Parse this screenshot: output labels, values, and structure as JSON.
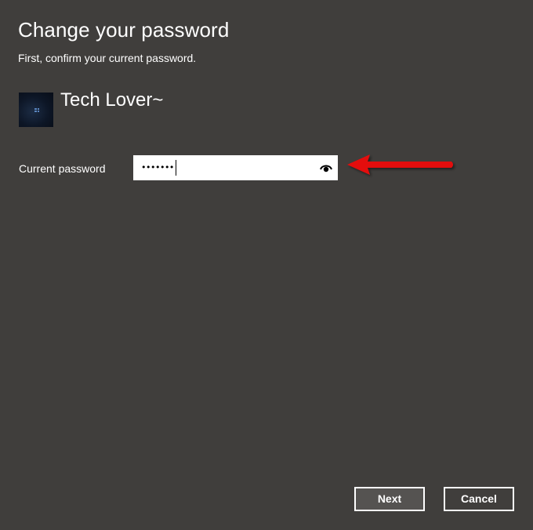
{
  "dialog": {
    "title": "Change your password",
    "subtitle": "First, confirm your current password."
  },
  "user": {
    "name": "Tech Lover~",
    "avatar_icon": "windows-logo-icon"
  },
  "password_field": {
    "label": "Current password",
    "value": "•••••••",
    "reveal_icon": "eye-icon"
  },
  "annotation": {
    "arrow_color": "#e30b0b",
    "arrow_icon": "red-arrow-icon"
  },
  "buttons": {
    "next_label": "Next",
    "cancel_label": "Cancel"
  },
  "colors": {
    "background": "#403e3c",
    "text": "#ffffff",
    "input_background": "#ffffff"
  }
}
